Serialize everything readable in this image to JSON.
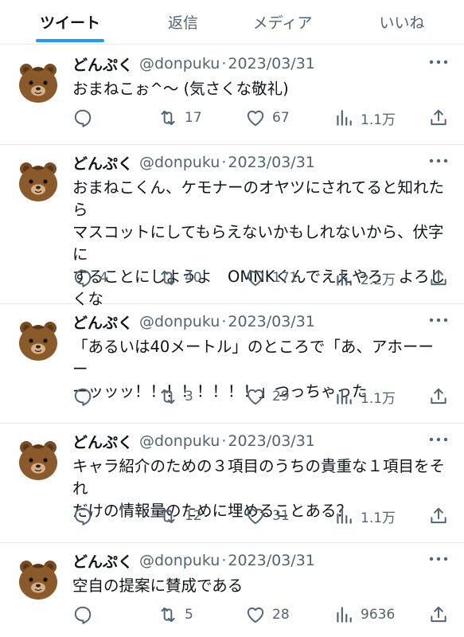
{
  "tabs": [
    {
      "label": "ツイート",
      "active": true
    },
    {
      "label": "返信",
      "active": false
    },
    {
      "label": "メディア",
      "active": false
    },
    {
      "label": "いいね",
      "active": false
    }
  ],
  "colors": {
    "accent": "#1d9bf0",
    "text": "#0f1419",
    "secondary": "#536471",
    "avatar": "#8a5a2b"
  },
  "tweets": [
    {
      "name": "どんぷく",
      "handle": "@donpuku",
      "date": "2023/03/31",
      "text": "おまねこぉ^〜 (気さくな敬礼)",
      "reply": "",
      "retweet": "17",
      "like": "67",
      "views": "1.1万"
    },
    {
      "name": "どんぷく",
      "handle": "@donpuku",
      "date": "2023/03/31",
      "text": "おまねこくん、ケモナーのオヤツにされてると知れたら\nマスコットにしてもらえないかもしれないから、伏字に\nすることにしようよ　OMNKくんでええやろ　よろし\nくな",
      "reply": "4",
      "retweet": "40",
      "like": "171",
      "views": "2.2万"
    },
    {
      "name": "どんぷく",
      "handle": "@donpuku",
      "date": "2023/03/31",
      "text": "「あるいは40メートル」のところで「あ、アホーーー\nーッッッ！！！！！！！！」つっちゃった",
      "reply": "",
      "retweet": "3",
      "like": "29",
      "views": "1.1万"
    },
    {
      "name": "どんぷく",
      "handle": "@donpuku",
      "date": "2023/03/31",
      "text": "キャラ紹介のための３項目のうちの貴重な１項目をそれ\nだけの情報量のために埋めることある？",
      "reply": "",
      "retweet": "12",
      "like": "31",
      "views": "1.1万"
    },
    {
      "name": "どんぷく",
      "handle": "@donpuku",
      "date": "2023/03/31",
      "text": "空自の提案に賛成である",
      "reply": "",
      "retweet": "5",
      "like": "28",
      "views": "9636"
    }
  ]
}
